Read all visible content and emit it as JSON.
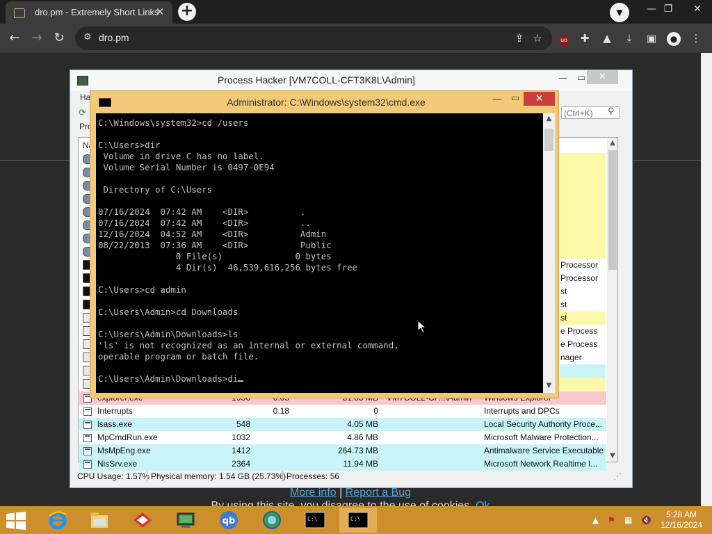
{
  "browser": {
    "tab_title": "dro.pm - Extremely Short Links",
    "url": "dro.pm",
    "tab_close": "✕",
    "new_tab": "+"
  },
  "page": {
    "footer_more_info": "More info",
    "footer_separator": "|",
    "footer_report_bug": "Report a Bug",
    "footer_cookies": "By using this site, you disagree to the use of cookies.",
    "footer_ok": "Ok"
  },
  "process_hacker": {
    "title": "Process Hacker [VM7COLL-CFT3K8L\\Admin]",
    "menu_fragment": "Ha",
    "tab_fragment": "Pro",
    "header_fragment": "Na",
    "search_placeholder": "(Ctrl+K)",
    "right_fragments": [
      {
        "text": "",
        "bg": "#fbf8a8"
      },
      {
        "text": "",
        "bg": "#fbf8a8"
      },
      {
        "text": "",
        "bg": "#fbf8a8"
      },
      {
        "text": "",
        "bg": "#fbf8a8"
      },
      {
        "text": "",
        "bg": "#fbf8a8"
      },
      {
        "text": "",
        "bg": "#fbf8a8"
      },
      {
        "text": "",
        "bg": "#fbf8a8"
      },
      {
        "text": "",
        "bg": "#fbf8a8"
      },
      {
        "text": "Processor",
        "bg": "#ffffff"
      },
      {
        "text": "Processor",
        "bg": "#ffffff"
      },
      {
        "text": "st",
        "bg": "#ffffff"
      },
      {
        "text": "st",
        "bg": "#ffffff"
      },
      {
        "text": "st",
        "bg": "#fbf8a8"
      },
      {
        "text": "e Process",
        "bg": "#ffffff"
      },
      {
        "text": "e Process",
        "bg": "#ffffff"
      },
      {
        "text": "nager",
        "bg": "#ffffff"
      },
      {
        "text": "",
        "bg": "#c8f4f8"
      },
      {
        "text": "",
        "bg": "#fbf8a8"
      }
    ],
    "rows": [
      {
        "name": "explorer.exe",
        "pid": "1956",
        "cpu": "0.05",
        "mem": "31.05 MB",
        "user": "VM7COLL-CF...\\Admin",
        "desc": "Windows Explorer",
        "bg": "#f8c8cc"
      },
      {
        "name": "Interrupts",
        "pid": "",
        "cpu": "0.18",
        "mem": "0",
        "user": "",
        "desc": "Interrupts and DPCs",
        "bg": "#ffffff"
      },
      {
        "name": "lsass.exe",
        "pid": "548",
        "cpu": "",
        "mem": "4.05 MB",
        "user": "",
        "desc": "Local Security Authority Proce...",
        "bg": "#c8f4f8"
      },
      {
        "name": "MpCmdRun.exe",
        "pid": "1032",
        "cpu": "",
        "mem": "4.86 MB",
        "user": "",
        "desc": "Microsoft Malware Protection...",
        "bg": "#ffffff"
      },
      {
        "name": "MsMpEng.exe",
        "pid": "1412",
        "cpu": "",
        "mem": "264.73 MB",
        "user": "",
        "desc": "Antimalware Service Executable",
        "bg": "#c8f4f8"
      },
      {
        "name": "NisSrv.exe",
        "pid": "2364",
        "cpu": "",
        "mem": "11.94 MB",
        "user": "",
        "desc": "Microsoft Network Realtime I...",
        "bg": "#c8f4f8"
      }
    ],
    "status": {
      "cpu": "CPU Usage: 1.57%",
      "memory": "Physical memory: 1.54 GB (25.73%)",
      "processes": "Processes: 56"
    }
  },
  "cmd": {
    "title": "Administrator: C:\\Windows\\system32\\cmd.exe",
    "lines": [
      "C:\\Windows\\system32>cd /users",
      "",
      "C:\\Users>dir",
      " Volume in drive C has no label.",
      " Volume Serial Number is 0497-0E94",
      "",
      " Directory of C:\\Users",
      "",
      "07/16/2024  07:42 AM    <DIR>          .",
      "07/16/2024  07:42 AM    <DIR>          ..",
      "12/16/2024  04:52 AM    <DIR>          Admin",
      "08/22/2013  07:36 AM    <DIR>          Public",
      "               0 File(s)              0 bytes",
      "               4 Dir(s)  46,539,616,256 bytes free",
      "",
      "C:\\Users>cd admin",
      "",
      "C:\\Users\\Admin>cd Downloads",
      "",
      "C:\\Users\\Admin\\Downloads>ls",
      "'ls' is not recognized as an internal or external command,",
      "operable program or batch file.",
      ""
    ],
    "prompt": "C:\\Users\\Admin\\Downloads>di"
  },
  "taskbar": {
    "time": "5:28 AM",
    "date": "12/16/2024",
    "apps": [
      "ie-icon",
      "file-explorer-icon",
      "toolbox-icon",
      "network-monitor-icon",
      "qbittorrent-icon",
      "globe-icon",
      "cmd-icon",
      "cmd-icon"
    ]
  }
}
